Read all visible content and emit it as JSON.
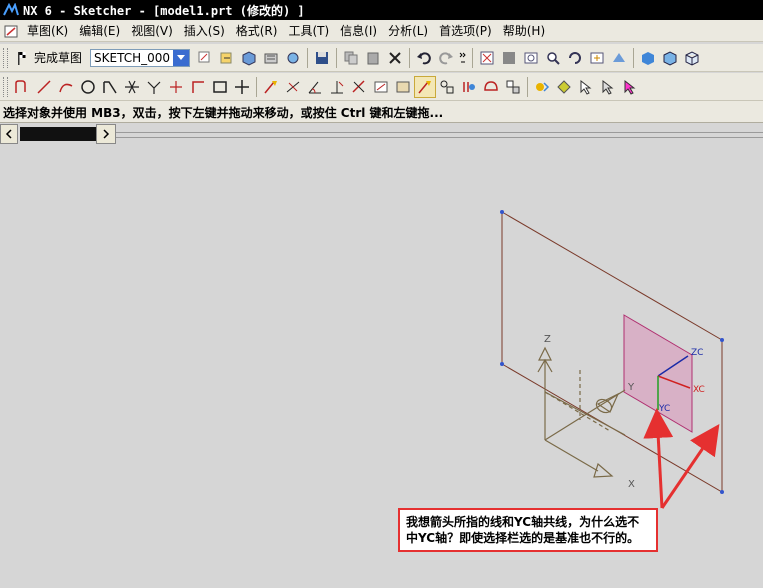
{
  "title": "NX 6 - Sketcher - [model1.prt (修改的) ]",
  "menu": [
    "草图(K)",
    "编辑(E)",
    "视图(V)",
    "插入(S)",
    "格式(R)",
    "工具(T)",
    "信息(I)",
    "分析(L)",
    "首选项(P)",
    "帮助(H)"
  ],
  "toolbar1": {
    "finish_label": "完成草图",
    "sketch_name": "SKETCH_000"
  },
  "cue_line": "选择对象并使用 MB3，双击，按下左键并拖动来移动，或按住 Ctrl 键和左键拖...",
  "viewport": {
    "axis_labels": {
      "z": "Z",
      "y": "Y",
      "x": "X"
    },
    "csys_labels": {
      "zc": "ZC",
      "xc": "XC",
      "yc": "YC"
    }
  },
  "annotation": "我想箭头所指的线和YC轴共线，为什么选不中YC轴？即使选择栏选的是基准也不行的。",
  "colors": {
    "annotation_border": "#e53030",
    "arrow": "#e53030",
    "plane_edge": "#7a3a2a",
    "plane_fill": "#d8a4c0",
    "datum_axis": "#7a6a48"
  }
}
